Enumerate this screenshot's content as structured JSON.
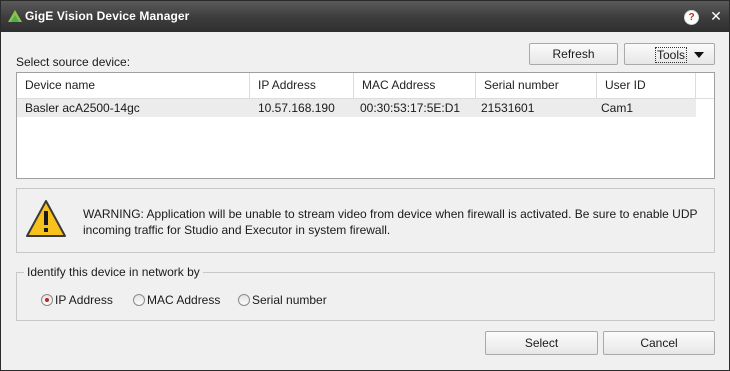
{
  "window": {
    "title": "GigE Vision Device Manager",
    "help_icon": "question-icon",
    "help_glyph": "?",
    "close_glyph": "✕",
    "accent_color": "#c0261b"
  },
  "source": {
    "label": "Select source device:",
    "refresh_label": "Refresh",
    "tools_label": "Tools"
  },
  "table": {
    "columns": [
      "Device name",
      "IP Address",
      "MAC Address",
      "Serial number",
      "User ID"
    ],
    "rows": [
      {
        "device_name": "Basler acA2500-14gc",
        "ip_address": "10.57.168.190",
        "mac_address": "00:30:53:17:5E:D1",
        "serial_number": "21531601",
        "user_id": "Cam1"
      }
    ]
  },
  "warning": {
    "icon": "warning-triangle-icon",
    "text": "WARNING: Application will be unable to stream video from device when firewall is activated. Be sure to enable UDP incoming traffic for Studio and Executor in system firewall."
  },
  "identify": {
    "label": "Identify this device in network by",
    "options": [
      {
        "label": "IP Address",
        "selected": true
      },
      {
        "label": "MAC Address",
        "selected": false
      },
      {
        "label": "Serial number",
        "selected": false
      }
    ]
  },
  "footer": {
    "select_label": "Select",
    "cancel_label": "Cancel"
  }
}
